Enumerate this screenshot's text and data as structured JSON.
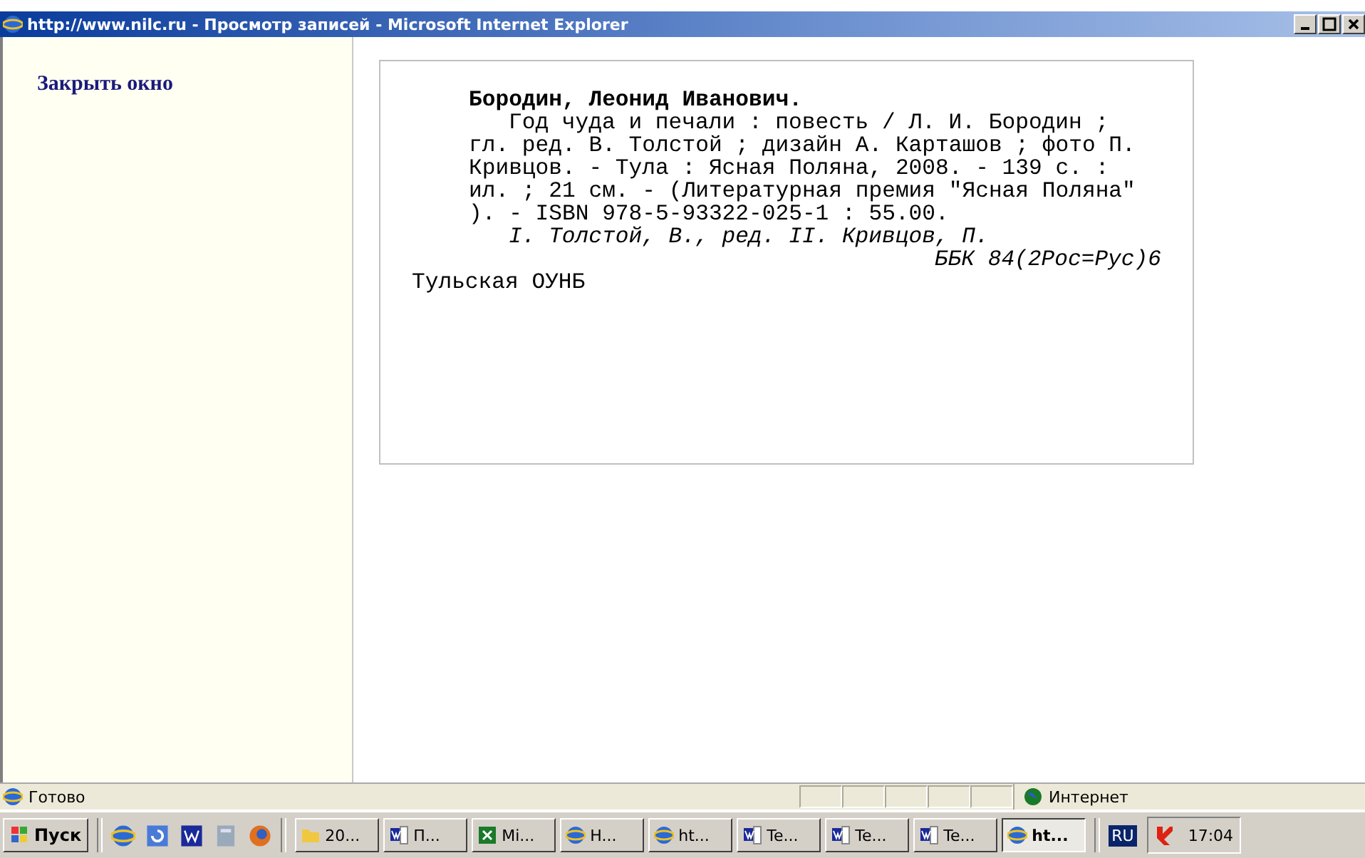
{
  "window": {
    "title": "http://www.nilc.ru - Просмотр записей - Microsoft Internet Explorer"
  },
  "sidebar": {
    "link": "Закрыть окно"
  },
  "record": {
    "heading": "Бородин, Леонид Иванович.",
    "body": "Год чуда и печали : повесть / Л. И. Бородин ; гл. ред. В. Толстой ; дизайн А. Карташов ; фото П. Кривцов. - Тула : Ясная Поляна, 2008. - 139 с. : ил. ; 21 см. - (Литературная премия \"Ясная Поляна\" ). - ISBN 978-5-93322-025-1 : 55.00.",
    "tracings": "I. Толстой, В., ред. II. Кривцов, П.",
    "classification": "ББК 84(2Рос=Рус)6",
    "library": "Тульская ОУНБ"
  },
  "status_bar": {
    "text": "Готово",
    "zone": "Интернет"
  },
  "taskbar": {
    "start": "Пуск",
    "buttons": [
      {
        "label": "20...",
        "kind": "folder",
        "selected": false
      },
      {
        "label": "П...",
        "kind": "word",
        "selected": false
      },
      {
        "label": "Mi...",
        "kind": "excel",
        "selected": false
      },
      {
        "label": "H...",
        "kind": "ie",
        "selected": false
      },
      {
        "label": "ht...",
        "kind": "ie",
        "selected": false
      },
      {
        "label": "Te...",
        "kind": "word",
        "selected": false
      },
      {
        "label": "Te...",
        "kind": "word",
        "selected": false
      },
      {
        "label": "Te...",
        "kind": "word",
        "selected": false
      },
      {
        "label": "ht...",
        "kind": "ie",
        "selected": true
      }
    ],
    "language": "RU",
    "clock": "17:04"
  }
}
